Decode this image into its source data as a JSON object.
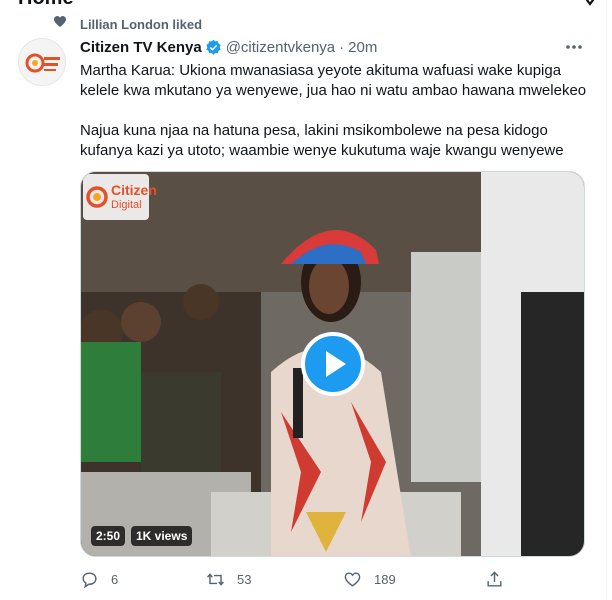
{
  "header": {
    "title": "Home"
  },
  "context": {
    "text": "Lillian London liked"
  },
  "tweet": {
    "display_name": "Citizen TV Kenya",
    "handle": "@citizentvkenya",
    "separator": "·",
    "time": "20m",
    "paragraphs": [
      "Martha Karua: Ukiona mwanasiasa yeyote akituma wafuasi wake kupiga kelele kwa mkutano ya wenyewe, jua hao ni watu ambao hawana mwelekeo",
      "Najua kuna njaa na hatuna pesa, lakini msikombolewe na pesa kidogo kufanya kazi ya utoto; waambie wenye kukutuma waje kwangu wenyewe"
    ]
  },
  "media": {
    "logo_line1": "Citizen",
    "logo_line2": "Digital",
    "duration": "2:50",
    "views": "1K views"
  },
  "actions": {
    "replies": "6",
    "retweets": "53",
    "likes": "189"
  },
  "colors": {
    "accent": "#1d9bf0",
    "muted": "#536471",
    "text": "#0f1419"
  }
}
